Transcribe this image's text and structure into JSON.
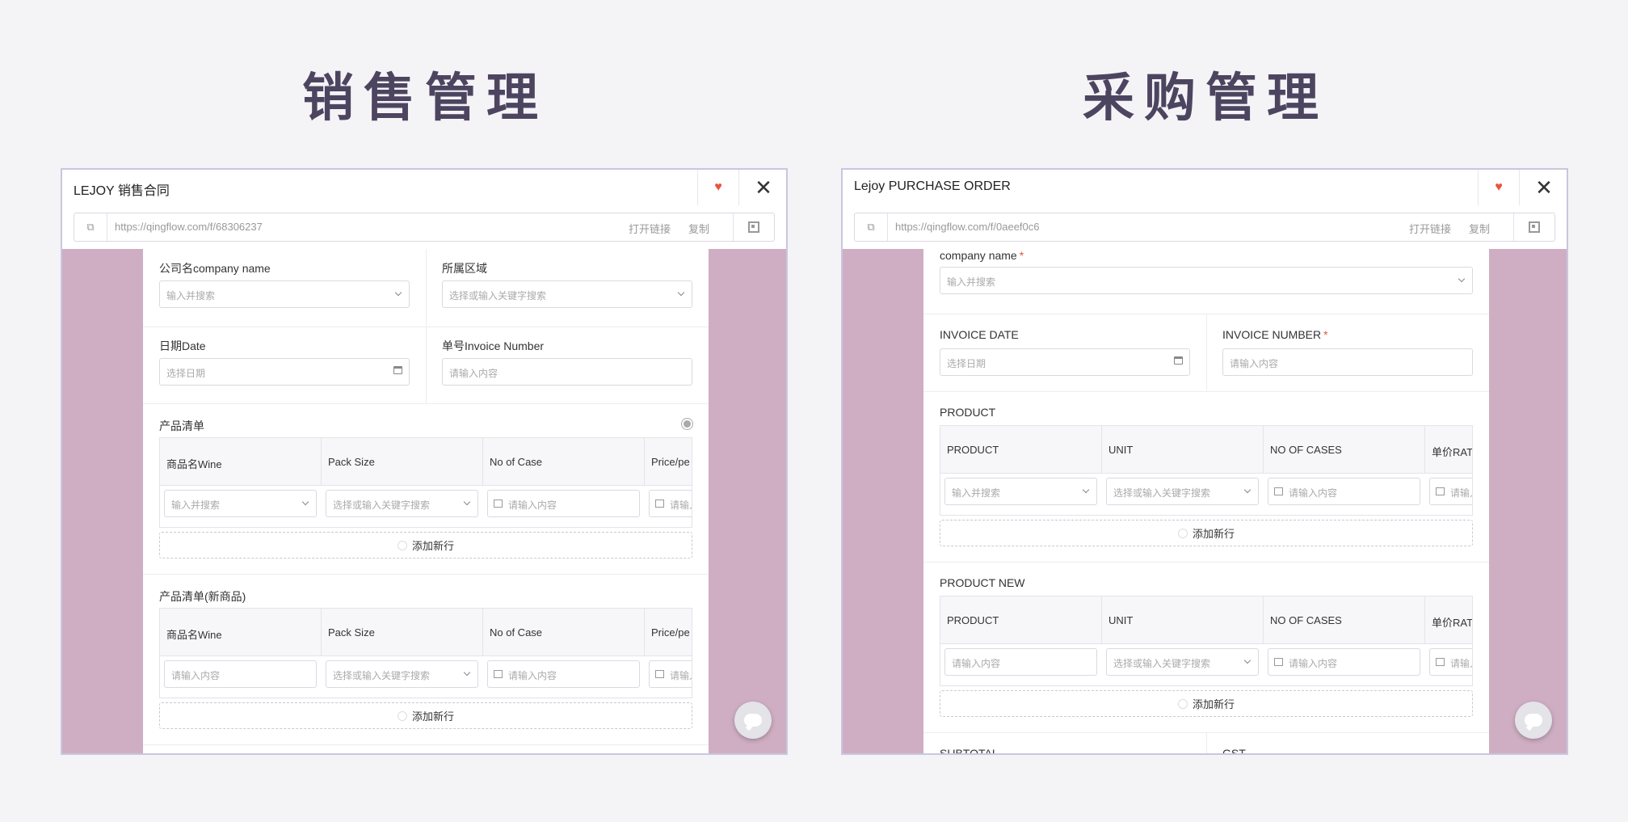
{
  "titles": {
    "left": "销售管理",
    "right": "采购管理"
  },
  "common": {
    "open_link": "打开链接",
    "copy": "复制",
    "add_row": "添加新行",
    "ph_search": "输入并搜索",
    "ph_select_or_search": "选择或输入关键字搜索",
    "ph_input": "请输入内容",
    "ph_input_short": "请输入",
    "ph_date": "选择日期",
    "colors": {
      "accent_heart": "#e8543e",
      "panel_bg": "#cfaec3",
      "title": "#4d4560"
    },
    "icons": [
      "heart-icon",
      "close-icon",
      "window-icon",
      "qr-code-icon",
      "chevron-down-icon",
      "calendar-icon",
      "image-icon",
      "timer-icon",
      "chat-icon"
    ]
  },
  "sales": {
    "window_title": "LEJOY 销售合同",
    "url": "https://qingflow.com/f/68306237",
    "company_label": "公司名company name",
    "region_label": "所属区域",
    "date_label": "日期Date",
    "invoice_label": "单号Invoice Number",
    "products_label": "产品清单",
    "products_new_label": "产品清单(新商品)",
    "columns": [
      "商品名Wine",
      "Pack Size",
      "No of Case",
      "Price/pe"
    ]
  },
  "purchase": {
    "window_title": "Lejoy PURCHASE ORDER",
    "url": "https://qingflow.com/f/0aeef0c6",
    "company_label": "company name",
    "invoice_date_label": "INVOICE DATE",
    "invoice_number_label": "INVOICE NUMBER",
    "product_label": "PRODUCT",
    "product_new_label": "PRODUCT NEW",
    "columns": [
      "PRODUCT",
      "UNIT",
      "NO OF CASES",
      "单价RAT"
    ],
    "subtotal_label": "SUBTOTAL",
    "gst_label": "GST"
  }
}
